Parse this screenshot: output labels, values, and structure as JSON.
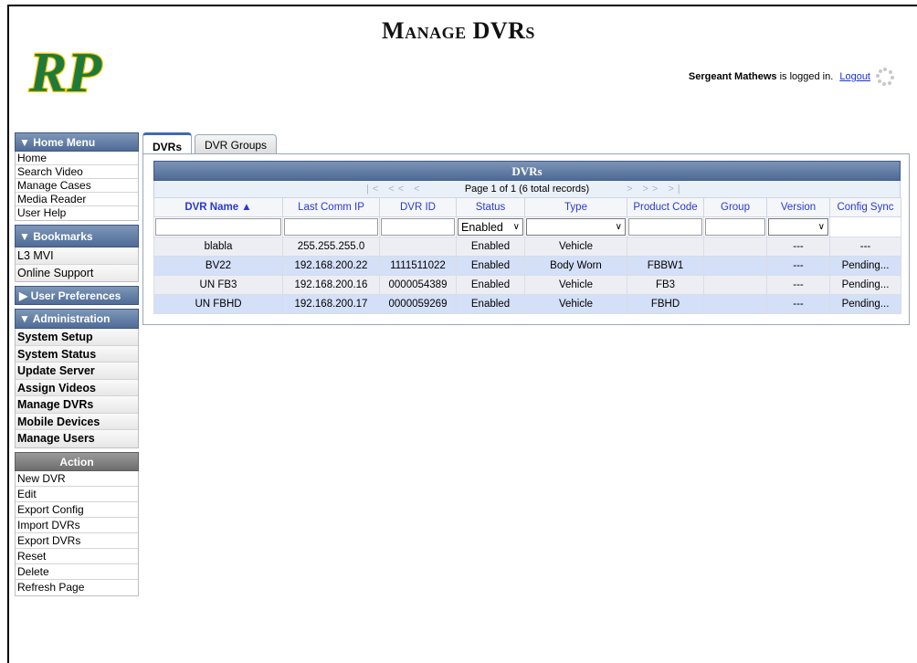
{
  "header": {
    "title": "Manage DVRs",
    "logo_text": "RP",
    "user": "Sergeant Mathews",
    "logged_in_text": " is logged in.",
    "logout": "Logout"
  },
  "sidebar": {
    "home_menu": {
      "title": "▼ Home Menu",
      "items": [
        "Home",
        "Search Video",
        "Manage Cases",
        "Media Reader",
        "User Help"
      ]
    },
    "bookmarks": {
      "title": "▼  Bookmarks",
      "items": [
        "L3 MVI",
        "Online Support"
      ]
    },
    "user_preferences": {
      "title": "▶ User Preferences"
    },
    "administration": {
      "title": "▼  Administration",
      "items": [
        "System Setup",
        "System Status",
        "Update Server",
        "Assign Videos",
        "Manage DVRs",
        "Mobile Devices",
        "Manage Users"
      ]
    },
    "action": {
      "title": "Action",
      "items": [
        "New DVR",
        "Edit",
        "Export Config",
        "Import DVRs",
        "Export DVRs",
        "Reset",
        "Delete",
        "Refresh Page"
      ]
    }
  },
  "tabs": [
    {
      "label": "DVRs",
      "active": true
    },
    {
      "label": "DVR Groups",
      "active": false
    }
  ],
  "grid": {
    "title": "DVRs",
    "pager_nav_left": "|<  <<  <",
    "pager_nav_right": ">  >>  >|",
    "pager_text": "Page 1 of 1 (6 total records)",
    "columns": [
      "DVR Name ▲",
      "Last Comm IP",
      "DVR ID",
      "Status",
      "Type",
      "Product Code",
      "Group",
      "Version",
      "Config Sync"
    ],
    "filter_status": "Enabled",
    "rows": [
      [
        "blabla",
        "255.255.255.0",
        "",
        "Enabled",
        "Vehicle",
        "",
        "",
        "---",
        "---"
      ],
      [
        "BV22",
        "192.168.200.22",
        "1111511022",
        "Enabled",
        "Body Worn",
        "FBBW1",
        "",
        "---",
        "Pending..."
      ],
      [
        "UN FB3",
        "192.168.200.16",
        "0000054389",
        "Enabled",
        "Vehicle",
        "FB3",
        "",
        "---",
        "Pending..."
      ],
      [
        "UN FBHD",
        "192.168.200.17",
        "0000059269",
        "Enabled",
        "Vehicle",
        "FBHD",
        "",
        "---",
        "Pending..."
      ]
    ]
  }
}
